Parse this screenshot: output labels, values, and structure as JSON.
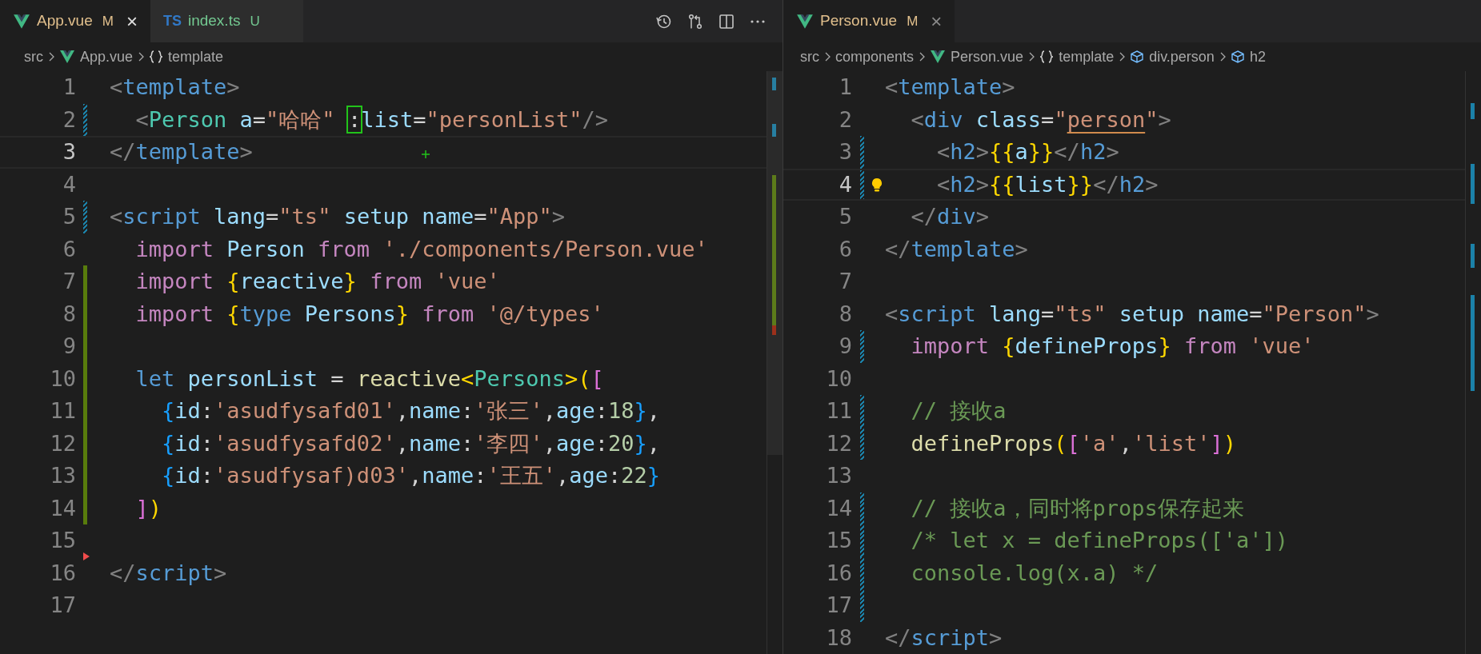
{
  "panes": [
    {
      "tabs": [
        {
          "kind": "vue",
          "label": "App.vue",
          "status": "M",
          "color": "#e2c08d",
          "close": "×",
          "selected": true
        },
        {
          "kind": "ts",
          "icon_text": "TS",
          "label": "index.ts",
          "status": "U",
          "color": "#73c991",
          "selected": false
        }
      ],
      "breadcrumbs": [
        {
          "kind": "folder",
          "text": "src"
        },
        {
          "kind": "vue",
          "text": "App.vue"
        },
        {
          "kind": "braces",
          "text": "template"
        }
      ],
      "lines": [
        {
          "number": "1",
          "kind": "plain",
          "current": false,
          "tokens": [
            {
              "kind": "punct",
              "text": "<"
            },
            {
              "kind": "tag",
              "text": "template"
            },
            {
              "kind": "punct",
              "text": ">"
            }
          ]
        },
        {
          "number": "2",
          "kind": "modified",
          "current": false,
          "tokens": [
            {
              "kind": "punct",
              "text": "  <"
            },
            {
              "kind": "type",
              "text": "Person"
            },
            {
              "kind": "attr",
              "text": " a"
            },
            {
              "kind": "plain",
              "text": "="
            },
            {
              "kind": "string",
              "text": "\"哈哈\" "
            },
            {
              "kind": "boxed",
              "text": ":"
            },
            {
              "kind": "attr",
              "text": "list"
            },
            {
              "kind": "plain",
              "text": "="
            },
            {
              "kind": "string",
              "text": "\"personList\""
            },
            {
              "kind": "punct",
              "text": "/>"
            }
          ]
        },
        {
          "number": "3",
          "kind": "plain",
          "current": true,
          "pointer": true,
          "tokens": [
            {
              "kind": "punct",
              "text": "</"
            },
            {
              "kind": "tag",
              "text": "template"
            },
            {
              "kind": "punct",
              "text": ">"
            }
          ]
        },
        {
          "number": "4",
          "kind": "plain",
          "current": false
        },
        {
          "number": "5",
          "kind": "modified",
          "current": false,
          "tokens": [
            {
              "kind": "punct",
              "text": "<"
            },
            {
              "kind": "tag",
              "text": "script"
            },
            {
              "kind": "attr",
              "text": " lang"
            },
            {
              "kind": "plain",
              "text": "="
            },
            {
              "kind": "string",
              "text": "\"ts\""
            },
            {
              "kind": "attr",
              "text": " setup name"
            },
            {
              "kind": "plain",
              "text": "="
            },
            {
              "kind": "string",
              "text": "\"App\""
            },
            {
              "kind": "punct",
              "text": ">"
            }
          ]
        },
        {
          "number": "6",
          "kind": "plain",
          "current": false,
          "tokens": [
            {
              "kind": "keyword",
              "text": "  import"
            },
            {
              "kind": "variable",
              "text": " Person"
            },
            {
              "kind": "keyword",
              "text": " from"
            },
            {
              "kind": "string",
              "text": " './components/Person.vue'"
            }
          ]
        },
        {
          "number": "7",
          "kind": "added",
          "current": false,
          "tokens": [
            {
              "kind": "keyword",
              "text": "  import"
            },
            {
              "kind": "bracket1",
              "text": " {"
            },
            {
              "kind": "variable",
              "text": "reactive"
            },
            {
              "kind": "bracket1",
              "text": "}"
            },
            {
              "kind": "keyword",
              "text": " from"
            },
            {
              "kind": "string",
              "text": " 'vue'"
            }
          ]
        },
        {
          "number": "8",
          "kind": "added",
          "current": false,
          "tokens": [
            {
              "kind": "keyword",
              "text": "  import"
            },
            {
              "kind": "bracket1",
              "text": " {"
            },
            {
              "kind": "storage",
              "text": "type"
            },
            {
              "kind": "variable",
              "text": " Persons"
            },
            {
              "kind": "bracket1",
              "text": "}"
            },
            {
              "kind": "keyword",
              "text": " from"
            },
            {
              "kind": "string",
              "text": " '@/types'"
            }
          ]
        },
        {
          "number": "9",
          "kind": "added",
          "current": false
        },
        {
          "number": "10",
          "kind": "added",
          "current": false,
          "tokens": [
            {
              "kind": "storage",
              "text": "  let"
            },
            {
              "kind": "variable",
              "text": " personList"
            },
            {
              "kind": "plain",
              "text": " = "
            },
            {
              "kind": "function",
              "text": "reactive"
            },
            {
              "kind": "bracket1",
              "text": "<"
            },
            {
              "kind": "type",
              "text": "Persons"
            },
            {
              "kind": "bracket1",
              "text": ">("
            },
            {
              "kind": "bracket2",
              "text": "["
            }
          ]
        },
        {
          "number": "11",
          "kind": "added",
          "current": false,
          "tokens": [
            {
              "kind": "bracket3",
              "text": "    {"
            },
            {
              "kind": "variable",
              "text": "id"
            },
            {
              "kind": "plain",
              "text": ":"
            },
            {
              "kind": "string",
              "text": "'asudfysafd01'"
            },
            {
              "kind": "plain",
              "text": ","
            },
            {
              "kind": "variable",
              "text": "name"
            },
            {
              "kind": "plain",
              "text": ":"
            },
            {
              "kind": "string",
              "text": "'张三'"
            },
            {
              "kind": "plain",
              "text": ","
            },
            {
              "kind": "variable",
              "text": "age"
            },
            {
              "kind": "plain",
              "text": ":"
            },
            {
              "kind": "number",
              "text": "18"
            },
            {
              "kind": "bracket3",
              "text": "}"
            },
            {
              "kind": "plain",
              "text": ","
            }
          ]
        },
        {
          "number": "12",
          "kind": "added",
          "current": false,
          "tokens": [
            {
              "kind": "bracket3",
              "text": "    {"
            },
            {
              "kind": "variable",
              "text": "id"
            },
            {
              "kind": "plain",
              "text": ":"
            },
            {
              "kind": "string",
              "text": "'asudfysafd02'"
            },
            {
              "kind": "plain",
              "text": ","
            },
            {
              "kind": "variable",
              "text": "name"
            },
            {
              "kind": "plain",
              "text": ":"
            },
            {
              "kind": "string",
              "text": "'李四'"
            },
            {
              "kind": "plain",
              "text": ","
            },
            {
              "kind": "variable",
              "text": "age"
            },
            {
              "kind": "plain",
              "text": ":"
            },
            {
              "kind": "number",
              "text": "20"
            },
            {
              "kind": "bracket3",
              "text": "}"
            },
            {
              "kind": "plain",
              "text": ","
            }
          ]
        },
        {
          "number": "13",
          "kind": "added",
          "current": false,
          "tokens": [
            {
              "kind": "bracket3",
              "text": "    {"
            },
            {
              "kind": "variable",
              "text": "id"
            },
            {
              "kind": "plain",
              "text": ":"
            },
            {
              "kind": "string",
              "text": "'asudfysaf)d03'"
            },
            {
              "kind": "plain",
              "text": ","
            },
            {
              "kind": "variable",
              "text": "name"
            },
            {
              "kind": "plain",
              "text": ":"
            },
            {
              "kind": "string",
              "text": "'王五'"
            },
            {
              "kind": "plain",
              "text": ","
            },
            {
              "kind": "variable",
              "text": "age"
            },
            {
              "kind": "plain",
              "text": ":"
            },
            {
              "kind": "number",
              "text": "22"
            },
            {
              "kind": "bracket3",
              "text": "}"
            }
          ]
        },
        {
          "number": "14",
          "kind": "added",
          "current": false,
          "tokens": [
            {
              "kind": "bracket2",
              "text": "  ]"
            },
            {
              "kind": "bracket1",
              "text": ")"
            }
          ]
        },
        {
          "number": "15",
          "kind": "plain",
          "current": false
        },
        {
          "number": "16",
          "kind": "deleted",
          "current": false,
          "tokens": [
            {
              "kind": "punct",
              "text": "</"
            },
            {
              "kind": "tag",
              "text": "script"
            },
            {
              "kind": "punct",
              "text": ">"
            }
          ]
        },
        {
          "number": "17",
          "kind": "plain",
          "current": false
        }
      ]
    },
    {
      "tabs": [
        {
          "kind": "vue",
          "label": "Person.vue",
          "status": "M",
          "color": "#e2c08d",
          "close": "×",
          "selected": true
        }
      ],
      "breadcrumbs": [
        {
          "kind": "folder",
          "text": "src"
        },
        {
          "kind": "folder",
          "text": "components"
        },
        {
          "kind": "vue",
          "text": "Person.vue"
        },
        {
          "kind": "braces",
          "text": "template"
        },
        {
          "kind": "element",
          "text": "div.person"
        },
        {
          "kind": "element",
          "text": "h2"
        }
      ],
      "lines": [
        {
          "number": "1",
          "kind": "plain",
          "current": false,
          "tokens": [
            {
              "kind": "punct",
              "text": "<"
            },
            {
              "kind": "tag",
              "text": "template"
            },
            {
              "kind": "punct",
              "text": ">"
            }
          ]
        },
        {
          "number": "2",
          "kind": "plain",
          "current": false,
          "tokens": [
            {
              "kind": "punct",
              "text": "  <"
            },
            {
              "kind": "tag",
              "text": "div"
            },
            {
              "kind": "attr",
              "text": " class"
            },
            {
              "kind": "plain",
              "text": "="
            },
            {
              "kind": "string",
              "text": "\""
            },
            {
              "kind": "squiggle",
              "text": "person"
            },
            {
              "kind": "string",
              "text": "\""
            },
            {
              "kind": "punct",
              "text": ">"
            }
          ]
        },
        {
          "number": "3",
          "kind": "modified",
          "current": false,
          "tokens": [
            {
              "kind": "punct",
              "text": "    <"
            },
            {
              "kind": "tag",
              "text": "h2"
            },
            {
              "kind": "punct",
              "text": ">"
            },
            {
              "kind": "bracket1",
              "text": "{{"
            },
            {
              "kind": "variable",
              "text": "a"
            },
            {
              "kind": "bracket1",
              "text": "}}"
            },
            {
              "kind": "punct",
              "text": "</"
            },
            {
              "kind": "tag",
              "text": "h2"
            },
            {
              "kind": "punct",
              "text": ">"
            }
          ]
        },
        {
          "number": "4",
          "kind": "modified",
          "current": true,
          "lightbulb": true,
          "tokens": [
            {
              "kind": "punct",
              "text": "    <"
            },
            {
              "kind": "tag",
              "text": "h2"
            },
            {
              "kind": "punct",
              "text": ">"
            },
            {
              "kind": "bracket1",
              "text": "{{"
            },
            {
              "kind": "variable",
              "text": "list"
            },
            {
              "kind": "bracket1",
              "text": "}}"
            },
            {
              "kind": "punct",
              "text": "</"
            },
            {
              "kind": "tag",
              "text": "h2"
            },
            {
              "kind": "punct",
              "text": ">"
            }
          ]
        },
        {
          "number": "5",
          "kind": "plain",
          "current": false,
          "tokens": [
            {
              "kind": "punct",
              "text": "  </"
            },
            {
              "kind": "tag",
              "text": "div"
            },
            {
              "kind": "punct",
              "text": ">"
            }
          ]
        },
        {
          "number": "6",
          "kind": "plain",
          "current": false,
          "tokens": [
            {
              "kind": "punct",
              "text": "</"
            },
            {
              "kind": "tag",
              "text": "template"
            },
            {
              "kind": "punct",
              "text": ">"
            }
          ]
        },
        {
          "number": "7",
          "kind": "plain",
          "current": false
        },
        {
          "number": "8",
          "kind": "plain",
          "current": false,
          "tokens": [
            {
              "kind": "punct",
              "text": "<"
            },
            {
              "kind": "tag",
              "text": "script"
            },
            {
              "kind": "attr",
              "text": " lang"
            },
            {
              "kind": "plain",
              "text": "="
            },
            {
              "kind": "string",
              "text": "\"ts\""
            },
            {
              "kind": "attr",
              "text": " setup name"
            },
            {
              "kind": "plain",
              "text": "="
            },
            {
              "kind": "string",
              "text": "\"Person\""
            },
            {
              "kind": "punct",
              "text": ">"
            }
          ]
        },
        {
          "number": "9",
          "kind": "modified",
          "current": false,
          "tokens": [
            {
              "kind": "keyword",
              "text": "  import"
            },
            {
              "kind": "bracket1",
              "text": " {"
            },
            {
              "kind": "variable",
              "text": "defineProps"
            },
            {
              "kind": "bracket1",
              "text": "}"
            },
            {
              "kind": "keyword",
              "text": " from"
            },
            {
              "kind": "string",
              "text": " 'vue'"
            }
          ]
        },
        {
          "number": "10",
          "kind": "plain",
          "current": false
        },
        {
          "number": "11",
          "kind": "modified",
          "current": false,
          "tokens": [
            {
              "kind": "comment",
              "text": "  // 接收a"
            }
          ]
        },
        {
          "number": "12",
          "kind": "modified",
          "current": false,
          "tokens": [
            {
              "kind": "function",
              "text": "  defineProps"
            },
            {
              "kind": "bracket1",
              "text": "("
            },
            {
              "kind": "bracket2",
              "text": "["
            },
            {
              "kind": "string",
              "text": "'a'"
            },
            {
              "kind": "plain",
              "text": ","
            },
            {
              "kind": "string",
              "text": "'list'"
            },
            {
              "kind": "bracket2",
              "text": "]"
            },
            {
              "kind": "bracket1",
              "text": ")"
            }
          ]
        },
        {
          "number": "13",
          "kind": "plain",
          "current": false
        },
        {
          "number": "14",
          "kind": "modified",
          "current": false,
          "tokens": [
            {
              "kind": "comment",
              "text": "  // 接收a，同时将props保存起来"
            }
          ]
        },
        {
          "number": "15",
          "kind": "modified",
          "current": false,
          "tokens": [
            {
              "kind": "comment",
              "text": "  /* let x = defineProps(['a'])"
            }
          ]
        },
        {
          "number": "16",
          "kind": "modified",
          "current": false,
          "tokens": [
            {
              "kind": "comment",
              "text": "  console.log(x.a) */"
            }
          ]
        },
        {
          "number": "17",
          "kind": "modified",
          "current": false
        },
        {
          "number": "18",
          "kind": "plain",
          "current": false,
          "tokens": [
            {
              "kind": "punct",
              "text": "</"
            },
            {
              "kind": "tag",
              "text": "script"
            },
            {
              "kind": "punct",
              "text": ">"
            }
          ]
        }
      ]
    }
  ]
}
